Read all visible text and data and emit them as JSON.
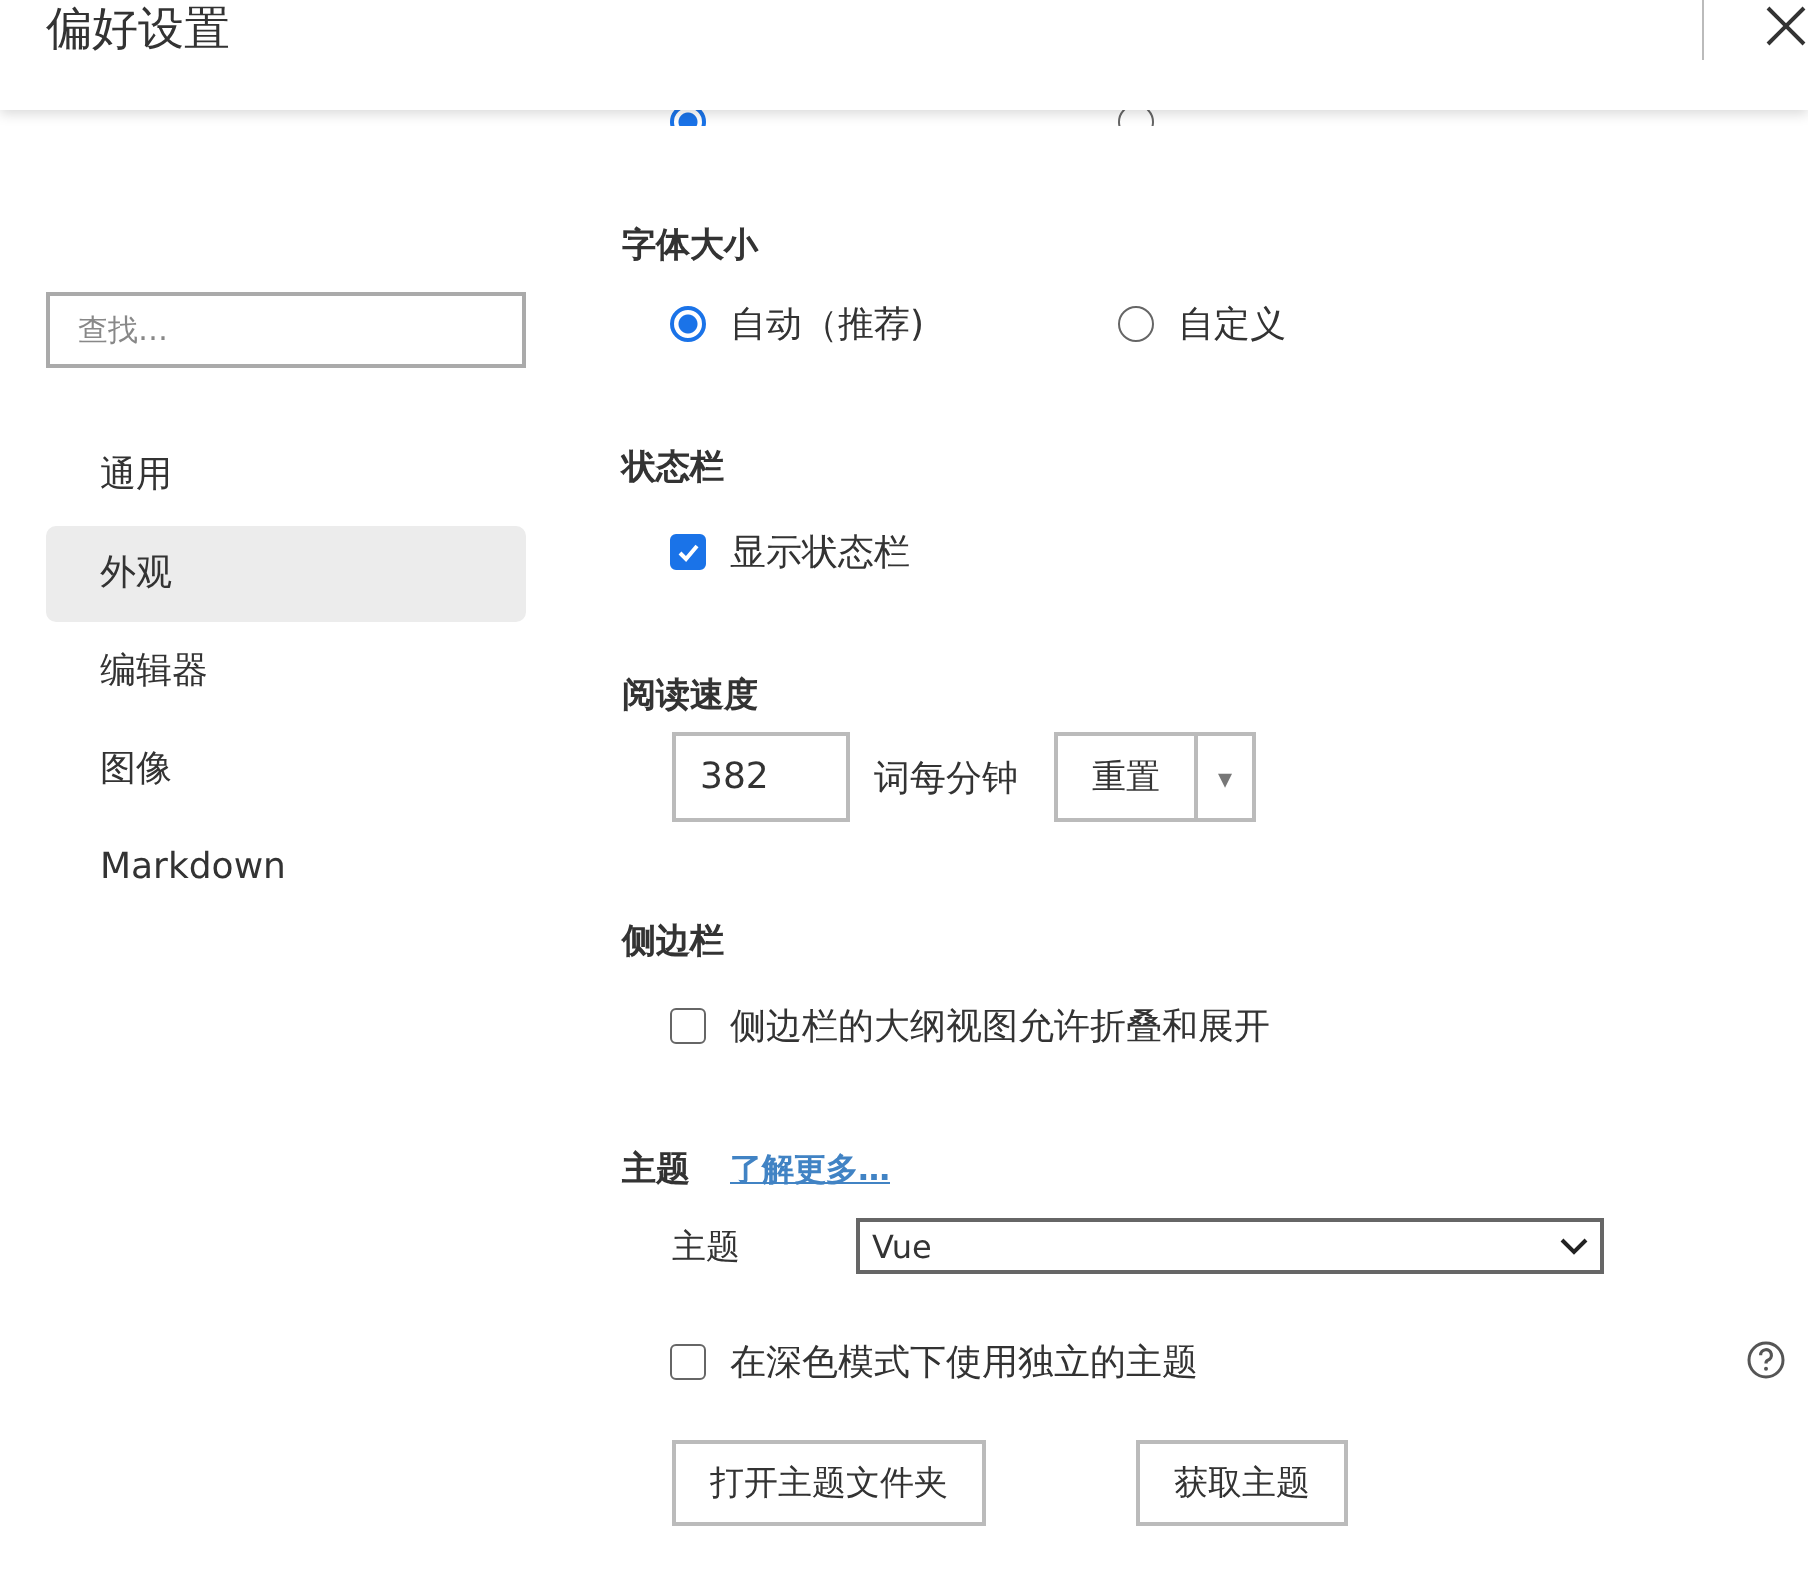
{
  "window": {
    "title": "偏好设置"
  },
  "top_radios": [
    {
      "selected": true
    },
    {
      "selected": false
    }
  ],
  "sidebar": {
    "search": {
      "placeholder": "查找…"
    },
    "items": [
      {
        "label": "通用",
        "selected": false
      },
      {
        "label": "外观",
        "selected": true
      },
      {
        "label": "编辑器",
        "selected": false
      },
      {
        "label": "图像",
        "selected": false
      },
      {
        "label": "Markdown",
        "selected": false
      }
    ]
  },
  "font_size": {
    "title": "字体大小",
    "options": [
      {
        "label": "自动（推荐)",
        "selected": true
      },
      {
        "label": "自定义",
        "selected": false
      }
    ]
  },
  "status_bar": {
    "title": "状态栏",
    "option": {
      "label": "显示状态栏",
      "checked": true
    }
  },
  "reading_speed": {
    "title": "阅读速度",
    "value": "382",
    "unit": "词每分钟",
    "button": "重置",
    "dropdown": "▾"
  },
  "side_bar": {
    "title": "侧边栏",
    "option": {
      "label": "侧边栏的大纲视图允许折叠和展开",
      "checked": false
    }
  },
  "theme": {
    "title": "主题",
    "link": "了解更多…",
    "label": "主题",
    "value": "Vue",
    "option": {
      "label": "在深色模式下使用独立的主题",
      "checked": false
    },
    "buttons": [
      "打开主题文件夹",
      "获取主题"
    ]
  }
}
